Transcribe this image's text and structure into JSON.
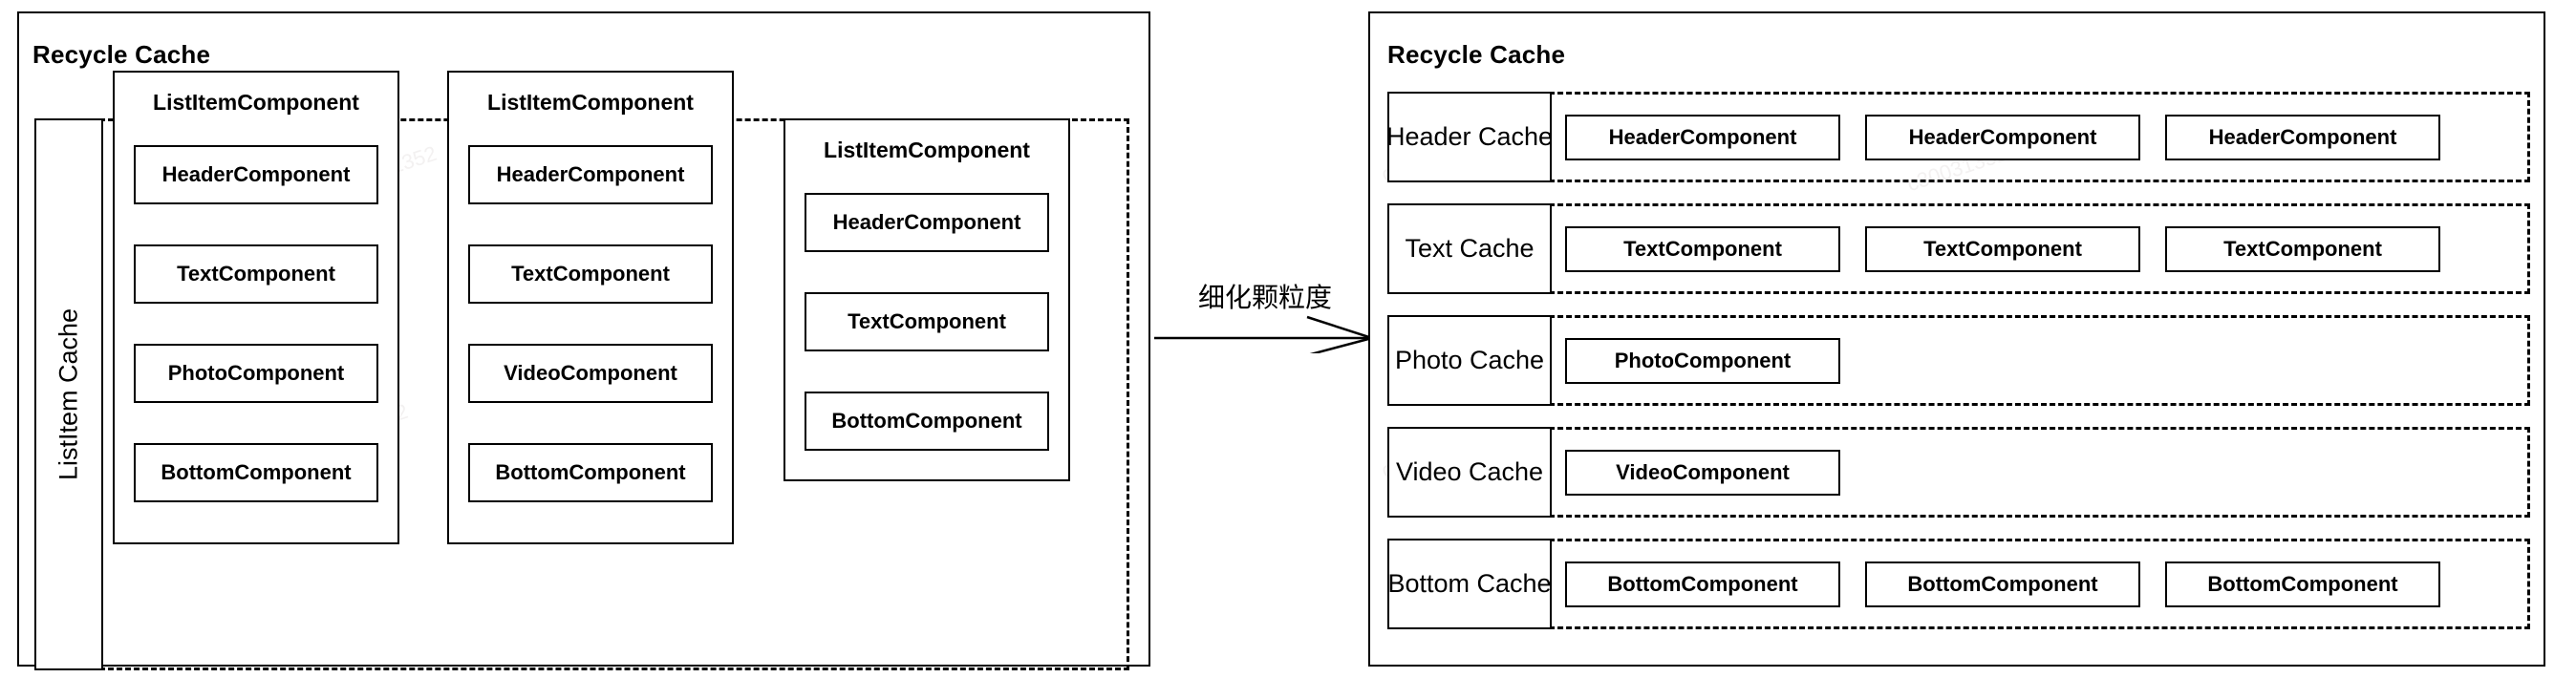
{
  "left_panel": {
    "title": "Recycle Cache",
    "cache_label": "ListItem Cache",
    "cards": [
      {
        "title": "ListItemComponent",
        "items": [
          "HeaderComponent",
          "TextComponent",
          "PhotoComponent",
          "BottomComponent"
        ]
      },
      {
        "title": "ListItemComponent",
        "items": [
          "HeaderComponent",
          "TextComponent",
          "VideoComponent",
          "BottomComponent"
        ]
      },
      {
        "title": "ListItemComponent",
        "items": [
          "HeaderComponent",
          "TextComponent",
          "BottomComponent"
        ]
      }
    ]
  },
  "transform": {
    "label": "细化颗粒度"
  },
  "right_panel": {
    "title": "Recycle Cache",
    "rows": [
      {
        "name": "Header Cache",
        "items": [
          "HeaderComponent",
          "HeaderComponent",
          "HeaderComponent"
        ]
      },
      {
        "name": "Text Cache",
        "items": [
          "TextComponent",
          "TextComponent",
          "TextComponent"
        ]
      },
      {
        "name": "Photo Cache",
        "items": [
          "PhotoComponent"
        ]
      },
      {
        "name": "Video Cache",
        "items": [
          "VideoComponent"
        ]
      },
      {
        "name": "Bottom Cache",
        "items": [
          "BottomComponent",
          "BottomComponent",
          "BottomComponent"
        ]
      }
    ]
  },
  "watermarks": [
    "c30031352",
    "c30031352",
    "c30031352",
    "c30031352",
    "c30031352",
    "c30031352"
  ],
  "colors": {
    "stroke": "#000000",
    "background": "#ffffff"
  }
}
